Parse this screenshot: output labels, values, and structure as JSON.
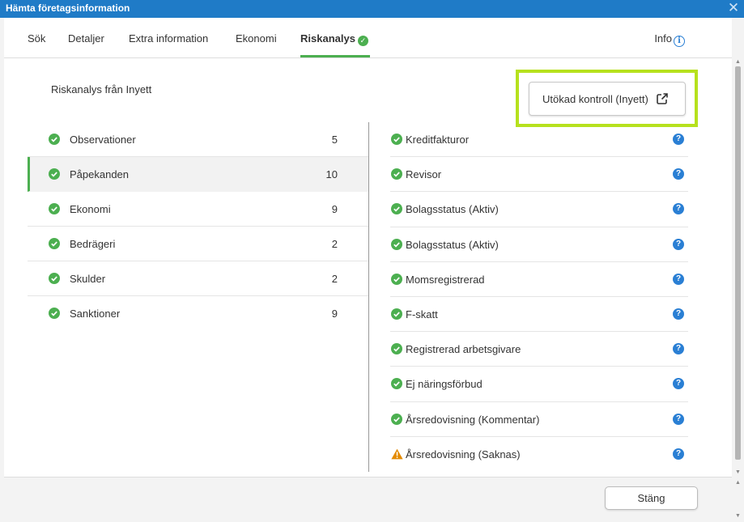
{
  "window": {
    "title": "Hämta företagsinformation",
    "close_glyph": "✕"
  },
  "tabs": [
    {
      "label": "Sök"
    },
    {
      "label": "Detaljer"
    },
    {
      "label": "Extra information"
    },
    {
      "label": "Ekonomi"
    },
    {
      "label": "Riskanalys",
      "active": true,
      "icon": "check-circle-icon"
    }
  ],
  "info": {
    "label": "Info",
    "icon_glyph": "i"
  },
  "riskanalys": {
    "title": "Riskanalys från Inyett",
    "extended_button": {
      "label": "Utökad kontroll (Inyett)",
      "icon": "external-link-icon"
    },
    "categories": [
      {
        "label": "Observationer",
        "count": "5"
      },
      {
        "label": "Påpekanden",
        "count": "10",
        "selected": true
      },
      {
        "label": "Ekonomi",
        "count": "9"
      },
      {
        "label": "Bedrägeri",
        "count": "2"
      },
      {
        "label": "Skulder",
        "count": "2"
      },
      {
        "label": "Sanktioner",
        "count": "9"
      }
    ],
    "items": [
      {
        "label": "Kreditfakturor",
        "status": "ok"
      },
      {
        "label": "Revisor",
        "status": "ok"
      },
      {
        "label": "Bolagsstatus (Aktiv)",
        "status": "ok"
      },
      {
        "label": "Bolagsstatus (Aktiv)",
        "status": "ok"
      },
      {
        "label": "Momsregistrerad",
        "status": "ok"
      },
      {
        "label": "F-skatt",
        "status": "ok"
      },
      {
        "label": "Registrerad arbetsgivare",
        "status": "ok"
      },
      {
        "label": "Ej näringsförbud",
        "status": "ok"
      },
      {
        "label": "Årsredovisning (Kommentar)",
        "status": "ok"
      },
      {
        "label": "Årsredovisning (Saknas)",
        "status": "warning"
      }
    ],
    "help_glyph": "?"
  },
  "footer": {
    "close_label": "Stäng"
  },
  "colors": {
    "titlebar": "#1f7bc7",
    "accent_green": "#4caf50",
    "highlight": "#b6e11d",
    "help_blue": "#2a7fd4",
    "warning": "#e38a00"
  }
}
